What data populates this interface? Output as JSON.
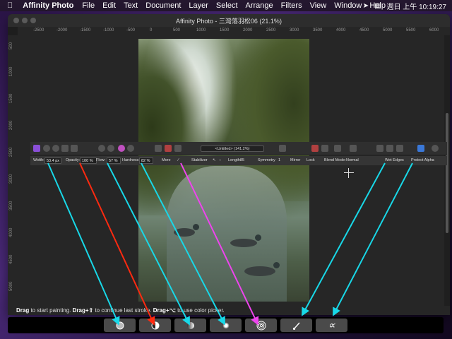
{
  "menubar": {
    "app_name": "Affinity Photo",
    "items": [
      "File",
      "Edit",
      "Text",
      "Document",
      "Layer",
      "Select",
      "Arrange",
      "Filters",
      "View",
      "Window",
      "Help"
    ],
    "clock": "週日 上午 10:19:27"
  },
  "window": {
    "title": "Affinity Photo - 三灣落羽松06 (21.1%)"
  },
  "ruler_top": [
    "-2500",
    "-2000",
    "-1500",
    "-1000",
    "-500",
    "0",
    "500",
    "1000",
    "1500",
    "2000",
    "2500",
    "3000",
    "3500",
    "4000",
    "4500",
    "5000",
    "5500",
    "6000",
    "6500"
  ],
  "ruler_left": [
    "500",
    "1000",
    "1500",
    "2000",
    "2500",
    "3000",
    "3500",
    "4000",
    "4500",
    "5000"
  ],
  "toolbar": {
    "document_selector": "<Untitled> (141.2%)",
    "width_label": "Width:",
    "width_value": "53.4 px",
    "opacity_label": "Opacity:",
    "opacity_value": "100 %",
    "flow_label": "Flow:",
    "flow_value": "57 %",
    "hardness_label": "Hardness:",
    "hardness_value": "82 %",
    "more_label": "More",
    "stabilizer_label": "Stabilizer",
    "length_label": "Length:",
    "length_value": "85",
    "symmetry_label": "Symmetry",
    "symmetry_value": "1",
    "mirror_label": "Mirror",
    "lock_label": "Lock",
    "blend_mode_label": "Blend Mode:",
    "blend_mode_value": "Normal",
    "wet_edges_label": "Wet Edges",
    "protect_alpha_label": "Protect Alpha"
  },
  "status": {
    "drag1": "Drag",
    "text1": " to start painting. ",
    "drag2": "Drag+⇧",
    "text2": " to continue last stroke. ",
    "drag3": "Drag+⌥",
    "text3": " to use color picker."
  },
  "touchbar": {
    "buttons": [
      {
        "name": "width-button",
        "icon": "circle-ring-icon"
      },
      {
        "name": "opacity-button",
        "icon": "half-circle-icon"
      },
      {
        "name": "flow-button",
        "icon": "gradient-circle-icon"
      },
      {
        "name": "hardness-button",
        "icon": "soft-dot-icon"
      },
      {
        "name": "stabilizer-button",
        "icon": "concentric-rings-icon"
      },
      {
        "name": "wet-edges-button",
        "icon": "brush-icon"
      },
      {
        "name": "protect-alpha-button",
        "icon": "alpha-icon",
        "label": "∝"
      }
    ]
  },
  "colors": {
    "arrow_cyan": "#18d8e8",
    "arrow_red": "#ff2a10",
    "arrow_magenta": "#ee44ee",
    "workspace": "#262626"
  }
}
